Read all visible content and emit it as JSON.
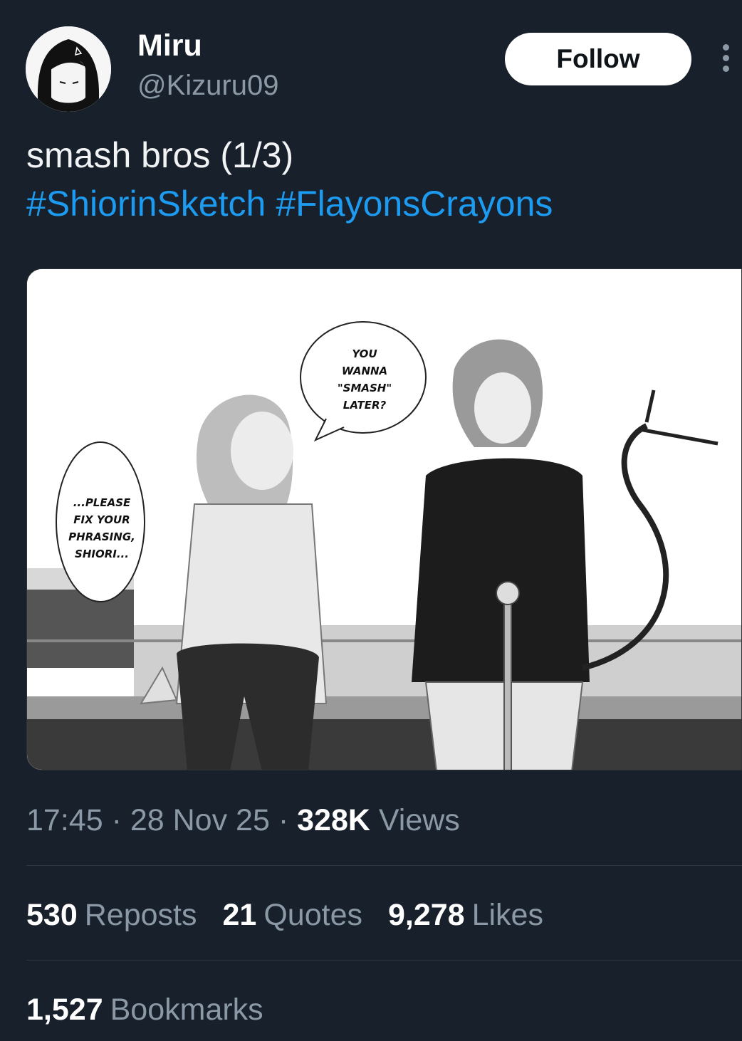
{
  "author": {
    "display_name": "Miru",
    "handle": "@Kizuru09"
  },
  "follow_label": "Follow",
  "tweet": {
    "text": "smash bros (1/3)",
    "hashtags": [
      "#ShiorinSketch",
      "#FlayonsCrayons"
    ]
  },
  "media": {
    "speech_bubbles": [
      {
        "lines": [
          "YOU",
          "WANNA",
          "\"SMASH\"",
          "LATER?"
        ]
      },
      {
        "lines": [
          "...PLEASE",
          "FIX YOUR",
          "PHRASING,",
          "SHIORI..."
        ]
      }
    ]
  },
  "meta": {
    "time": "17:45",
    "separator": "·",
    "date": "28 Nov 25",
    "views_count": "328K",
    "views_label": "Views"
  },
  "stats": {
    "reposts_count": "530",
    "reposts_label": "Reposts",
    "quotes_count": "21",
    "quotes_label": "Quotes",
    "likes_count": "9,278",
    "likes_label": "Likes",
    "bookmarks_count": "1,527",
    "bookmarks_label": "Bookmarks"
  },
  "colors": {
    "background": "#17202b",
    "hashtag": "#1d9bf0",
    "secondary_text": "#8b98a5",
    "follow_button": "#ffffff"
  }
}
